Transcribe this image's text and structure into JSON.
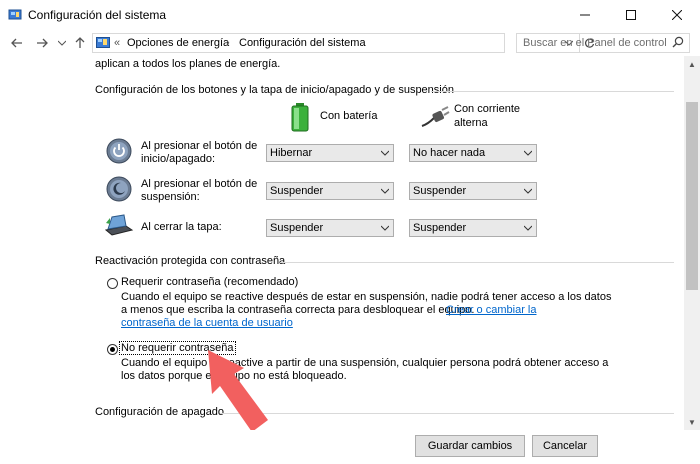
{
  "window": {
    "title": "Configuración del sistema"
  },
  "address": {
    "prefix": "«",
    "crumbs": [
      "Opciones de energía",
      "Configuración del sistema"
    ],
    "search_placeholder": "Buscar en el Panel de control"
  },
  "intro_text": "aplican a todos los planes de energía.",
  "buttons_section": {
    "heading": "Configuración de los botones y la tapa de inicio/apagado y de suspensión",
    "col_battery": "Con batería",
    "col_ac_line1": "Con corriente",
    "col_ac_line2": "alterna",
    "rows": [
      {
        "label_line1": "Al presionar el botón de",
        "label_line2": "inicio/apagado:",
        "battery": "Hibernar",
        "ac": "No hacer nada"
      },
      {
        "label_line1": "Al presionar el botón de",
        "label_line2": "suspensión:",
        "battery": "Suspender",
        "ac": "Suspender"
      },
      {
        "label_line1": "Al cerrar la tapa:",
        "label_line2": "",
        "battery": "Suspender",
        "ac": "Suspender"
      }
    ]
  },
  "password_section": {
    "heading": "Reactivación protegida con contraseña",
    "option1": {
      "label": "Requerir contraseña (recomendado)",
      "desc_line1": "Cuando el equipo se reactive después de estar en suspensión, nadie podrá tener acceso a los datos",
      "desc_line2": "a menos que escriba la contraseña correcta para desbloquear el equipo.",
      "link_part1": "Crear o cambiar la",
      "link_part2": "contraseña de la cuenta de usuario",
      "selected": false
    },
    "option2": {
      "label": "No requerir contraseña",
      "desc_line1": "Cuando el equipo se reactive a partir de una suspensión, cualquier persona podrá obtener acceso a",
      "desc_line2": "los datos porque el equipo no está bloqueado.",
      "selected": true
    }
  },
  "shutdown_section": {
    "heading": "Configuración de apagado"
  },
  "footer": {
    "save": "Guardar cambios",
    "cancel": "Cancelar"
  },
  "colors": {
    "arrow": "#f2605f",
    "link": "#0066cc"
  }
}
